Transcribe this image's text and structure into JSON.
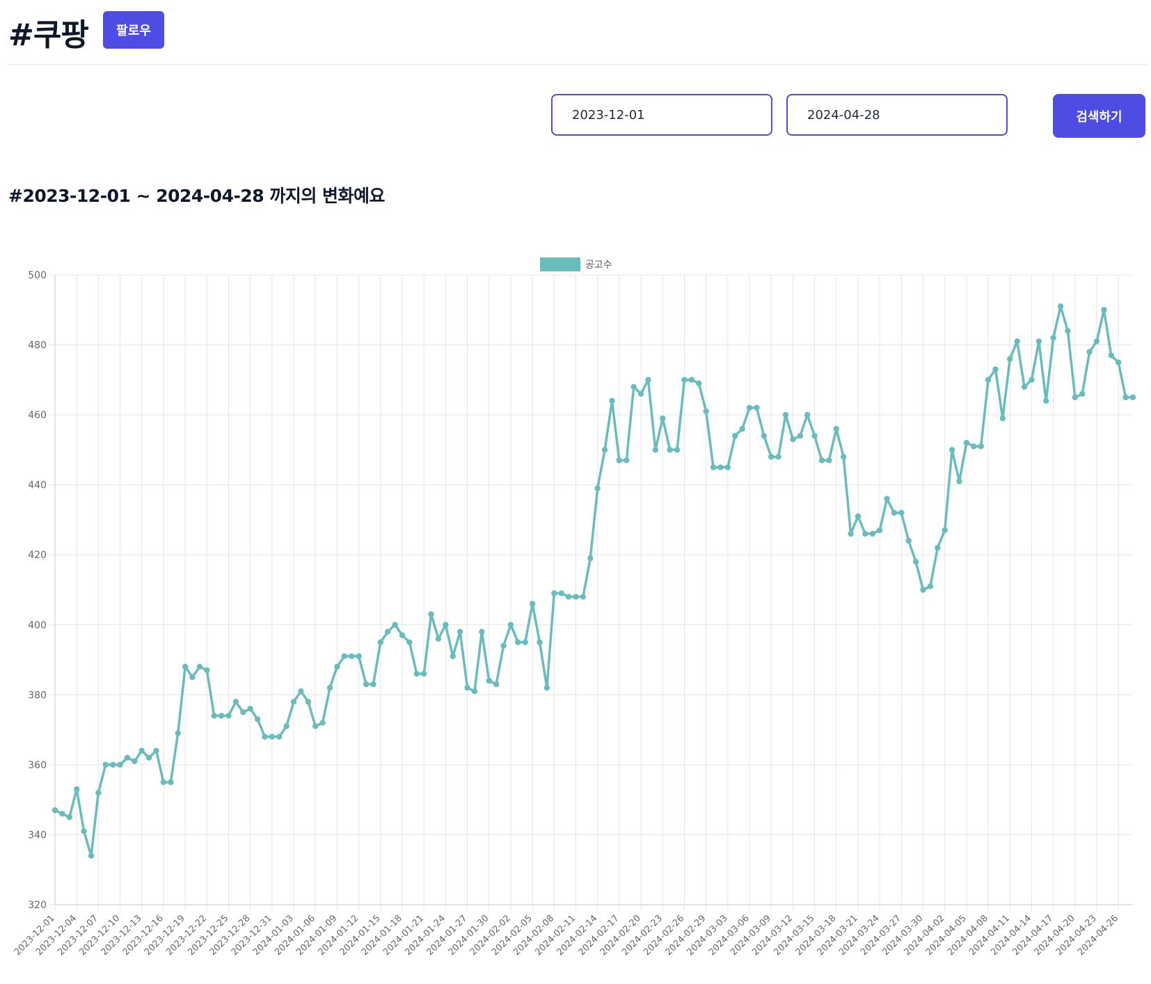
{
  "header": {
    "title": "#쿠팡",
    "follow_label": "팔로우"
  },
  "search": {
    "start_date": "2023-12-01",
    "end_date": "2024-04-28",
    "separator": "~",
    "button_label": "검색하기"
  },
  "range_title": "#2023-12-01 ~ 2024-04-28 까지의 변화예요",
  "colors": {
    "accent": "#4f4ce3",
    "series": "#69bcbc",
    "grid": "#e5e5e5"
  },
  "chart_data": {
    "type": "line",
    "legend_position": "top-center",
    "grid": true,
    "xlabel": "",
    "ylabel": "",
    "ylim": [
      320,
      500
    ],
    "yticks": [
      320,
      340,
      360,
      380,
      400,
      420,
      440,
      460,
      480,
      500
    ],
    "x_start": "2023-12-01",
    "x_end": "2024-04-28",
    "x_tick_step_days": 3,
    "series": [
      {
        "name": "공고수",
        "values": [
          347,
          346,
          345,
          353,
          341,
          334,
          352,
          360,
          360,
          360,
          362,
          361,
          364,
          362,
          364,
          355,
          355,
          369,
          388,
          385,
          388,
          387,
          374,
          374,
          374,
          378,
          375,
          376,
          373,
          368,
          368,
          368,
          371,
          378,
          381,
          378,
          371,
          372,
          382,
          388,
          391,
          391,
          391,
          383,
          383,
          395,
          398,
          400,
          397,
          395,
          386,
          386,
          403,
          396,
          400,
          391,
          398,
          382,
          381,
          398,
          384,
          383,
          394,
          400,
          395,
          395,
          406,
          395,
          382,
          409,
          409,
          408,
          408,
          408,
          419,
          439,
          450,
          464,
          447,
          447,
          468,
          466,
          470,
          450,
          459,
          450,
          450,
          470,
          470,
          469,
          461,
          445,
          445,
          445,
          454,
          456,
          462,
          462,
          454,
          448,
          448,
          460,
          453,
          454,
          460,
          454,
          447,
          447,
          456,
          448,
          426,
          431,
          426,
          426,
          427,
          436,
          432,
          432,
          424,
          418,
          410,
          411,
          422,
          427,
          450,
          441,
          452,
          451,
          451,
          470,
          473,
          459,
          476,
          481,
          468,
          470,
          481,
          464,
          482,
          491,
          484,
          465,
          466,
          478,
          481,
          490,
          477,
          475,
          465,
          465
        ]
      }
    ]
  }
}
